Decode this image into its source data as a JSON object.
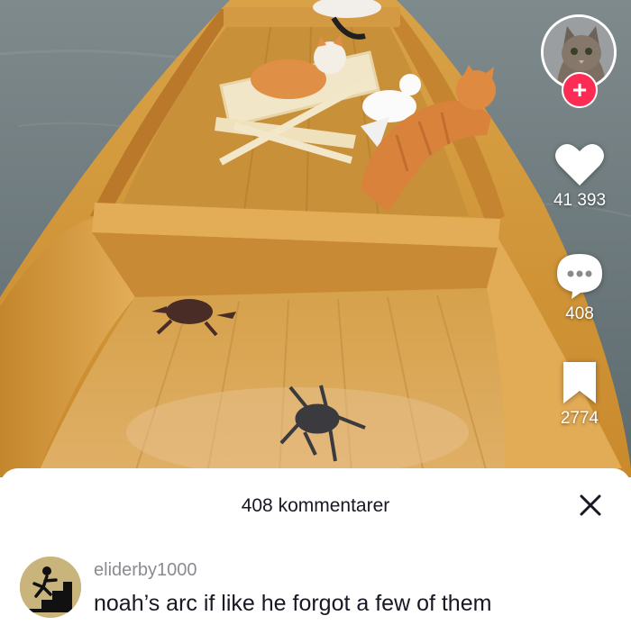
{
  "video": {
    "scene_description_icon": "boat-with-cats-bird-crabs-image"
  },
  "rail": {
    "follow_symbol": "+",
    "likes": "41 393",
    "comments": "408",
    "saves": "2774"
  },
  "comments_sheet": {
    "title": "408 kommentarer",
    "close_symbol": "close-icon",
    "comment": {
      "username": "eliderby1000",
      "text": "noah’s arc if like he forgot a few of them"
    }
  },
  "colors": {
    "follow_accent": "#fe2c55",
    "boat_wood": "#d39a3c",
    "water": "#6f7d80",
    "text_primary": "#161823",
    "text_secondary": "#8a8b91"
  }
}
